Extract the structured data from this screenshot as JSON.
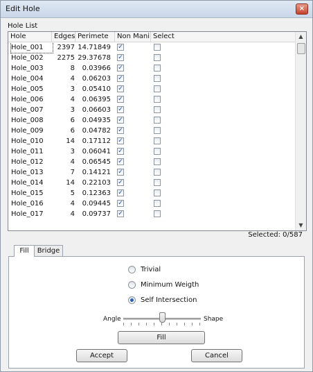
{
  "window": {
    "title": "Edit Hole",
    "close_glyph": "×"
  },
  "hole_list": {
    "group_label": "Hole List",
    "columns": [
      "Hole",
      "Edges",
      "Perimete",
      "Non Mani",
      "Select"
    ],
    "rows": [
      {
        "hole": "Hole_001",
        "edges": "2397",
        "perimeter": "14.71849",
        "non_manifold": true,
        "select": false
      },
      {
        "hole": "Hole_002",
        "edges": "2275",
        "perimeter": "29.37678",
        "non_manifold": true,
        "select": false
      },
      {
        "hole": "Hole_003",
        "edges": "8",
        "perimeter": "0.03966",
        "non_manifold": true,
        "select": false
      },
      {
        "hole": "Hole_004",
        "edges": "4",
        "perimeter": "0.06203",
        "non_manifold": true,
        "select": false
      },
      {
        "hole": "Hole_005",
        "edges": "3",
        "perimeter": "0.05410",
        "non_manifold": true,
        "select": false
      },
      {
        "hole": "Hole_006",
        "edges": "4",
        "perimeter": "0.06395",
        "non_manifold": true,
        "select": false
      },
      {
        "hole": "Hole_007",
        "edges": "3",
        "perimeter": "0.06603",
        "non_manifold": true,
        "select": false
      },
      {
        "hole": "Hole_008",
        "edges": "6",
        "perimeter": "0.04935",
        "non_manifold": true,
        "select": false
      },
      {
        "hole": "Hole_009",
        "edges": "6",
        "perimeter": "0.04782",
        "non_manifold": true,
        "select": false
      },
      {
        "hole": "Hole_010",
        "edges": "14",
        "perimeter": "0.17112",
        "non_manifold": true,
        "select": false
      },
      {
        "hole": "Hole_011",
        "edges": "3",
        "perimeter": "0.06041",
        "non_manifold": true,
        "select": false
      },
      {
        "hole": "Hole_012",
        "edges": "4",
        "perimeter": "0.06545",
        "non_manifold": true,
        "select": false
      },
      {
        "hole": "Hole_013",
        "edges": "7",
        "perimeter": "0.14121",
        "non_manifold": true,
        "select": false
      },
      {
        "hole": "Hole_014",
        "edges": "14",
        "perimeter": "0.22103",
        "non_manifold": true,
        "select": false
      },
      {
        "hole": "Hole_015",
        "edges": "5",
        "perimeter": "0.12363",
        "non_manifold": true,
        "select": false
      },
      {
        "hole": "Hole_016",
        "edges": "4",
        "perimeter": "0.09445",
        "non_manifold": true,
        "select": false
      },
      {
        "hole": "Hole_017",
        "edges": "4",
        "perimeter": "0.09737",
        "non_manifold": true,
        "select": false
      }
    ],
    "selected_text": "Selected: 0/587"
  },
  "tabs": [
    "Fill",
    "Bridge"
  ],
  "fill_panel": {
    "options": [
      {
        "label": "Trivial",
        "checked": false
      },
      {
        "label": "Minimum Weigth",
        "checked": false
      },
      {
        "label": "Self Intersection",
        "checked": true
      }
    ],
    "slider_left_label": "Angle",
    "slider_right_label": "Shape",
    "slider_value": 0.5,
    "fill_button": "Fill"
  },
  "buttons": {
    "accept": "Accept",
    "cancel": "Cancel"
  },
  "icons": {
    "close": "close-icon",
    "scroll_up": "scroll-up-icon",
    "scroll_down": "scroll-down-icon"
  }
}
